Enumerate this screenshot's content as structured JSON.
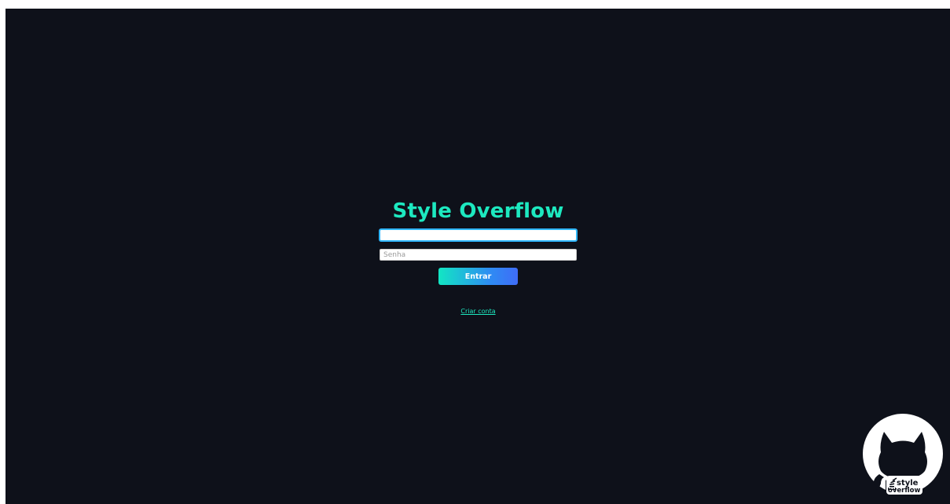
{
  "app": {
    "title": "Style Overflow"
  },
  "form": {
    "username_value": "",
    "username_placeholder": "",
    "password_value": "",
    "password_placeholder": "Senha",
    "submit_label": "Entrar",
    "create_account_label": "Criar conta"
  },
  "badge": {
    "line1": "style",
    "line2": "overflow",
    "icon": "github-octocat-icon"
  },
  "colors": {
    "background": "#0e111a",
    "accent": "#1de9c0",
    "button_gradient_start": "#12e6c3",
    "button_gradient_end": "#3f6cf7"
  }
}
